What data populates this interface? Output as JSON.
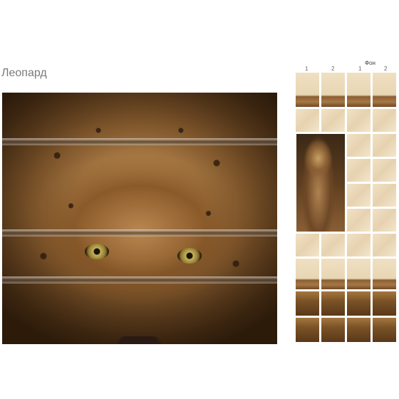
{
  "title": "Леопард",
  "scheme": {
    "fon_label": "Фон",
    "columns": [
      "1",
      "2",
      "1",
      "2"
    ]
  }
}
